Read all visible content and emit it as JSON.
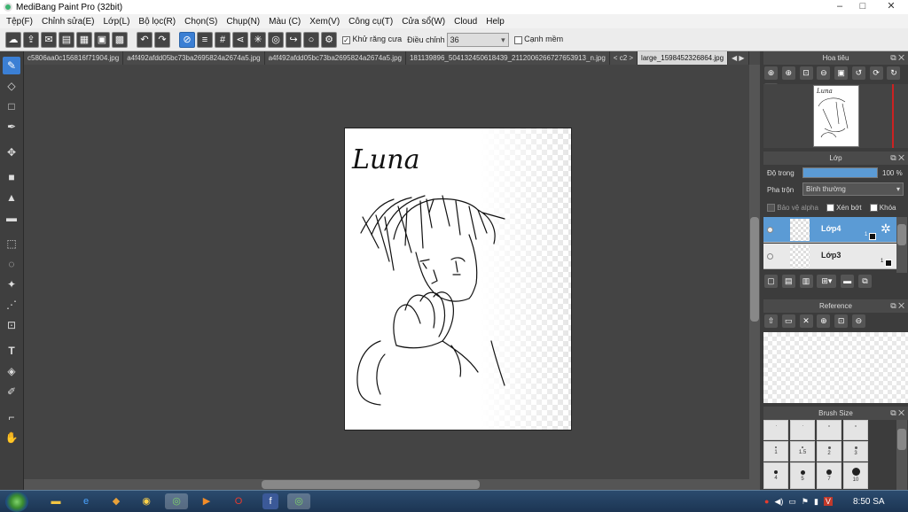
{
  "window": {
    "title": "MediBang Paint Pro (32bit)",
    "minimize": "–",
    "maximize": "□",
    "close": "✕"
  },
  "menu": [
    "Tệp(F)",
    "Chỉnh sửa(E)",
    "Lớp(L)",
    "Bộ lọc(R)",
    "Chọn(S)",
    "Chụp(N)",
    "Màu (C)",
    "Xem(V)",
    "Công cụ(T)",
    "Cửa sổ(W)",
    "Cloud",
    "Help"
  ],
  "toolbar": {
    "antialias_label": "Khử răng cưa",
    "adjust_label": "Điều chỉnh",
    "adjust_value": "36",
    "edge_label": "Cạnh mềm"
  },
  "tabs": [
    "c5806aa0c156816f71904.jpg",
    "a4f492afdd05bc73ba2695824a2674a5.jpg",
    "a4f492afdd05bc73ba2695824a2674a5.jpg",
    "181139896_504132450618439_2112006266727653913_n.jpg",
    "large_1598452326864.jpg"
  ],
  "tab_overflow": "< c2 >",
  "canvas": {
    "signature": "Luna"
  },
  "navigator": {
    "title": "Hoa tiêu",
    "preview_text": "Luna"
  },
  "layer_panel": {
    "title": "Lớp",
    "opacity_label": "Độ trong",
    "opacity_value": "100 %",
    "opacity_fraction": 1.0,
    "blend_label": "Pha trộn",
    "blend_value": "Bình thường",
    "protect_alpha": "Bảo vệ alpha",
    "clip": "Xén bớt",
    "lock": "Khóa",
    "layers": [
      {
        "name": "Lớp4",
        "num": "1",
        "active": true
      },
      {
        "name": "Lớp3",
        "num": "1",
        "active": false
      }
    ]
  },
  "reference": {
    "title": "Reference"
  },
  "brush_size": {
    "title": "Brush Size",
    "sizes": [
      "1",
      "1.5",
      "2",
      "3",
      "4",
      "5",
      "7",
      "10"
    ]
  },
  "taskbar": {
    "time": "8:50 SA"
  }
}
